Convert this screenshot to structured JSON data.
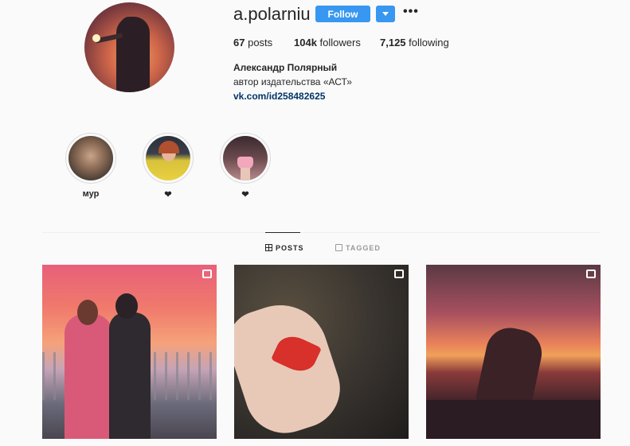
{
  "profile": {
    "username": "a.polarniu",
    "follow_label": "Follow",
    "more_label": "•••",
    "posts_count": "67",
    "posts_label": "posts",
    "followers_count": "104k",
    "followers_label": "followers",
    "following_count": "7,125",
    "following_label": "following",
    "full_name": "Александр Полярный",
    "bio": "автор издательства «АСТ»",
    "link": "vk.com/id258482625"
  },
  "highlights": [
    {
      "label": "мур"
    },
    {
      "label": "❤"
    },
    {
      "label": "❤"
    }
  ],
  "tabs": [
    {
      "label": "POSTS",
      "active": true,
      "icon": "grid-icon"
    },
    {
      "label": "TAGGED",
      "active": false,
      "icon": "tag-icon"
    }
  ],
  "posts": [
    {
      "type": "video",
      "icon": "video-icon"
    },
    {
      "type": "carousel",
      "icon": "carousel-icon"
    },
    {
      "type": "carousel",
      "icon": "carousel-icon"
    }
  ],
  "colors": {
    "accent": "#3897f0",
    "link": "#003569"
  }
}
